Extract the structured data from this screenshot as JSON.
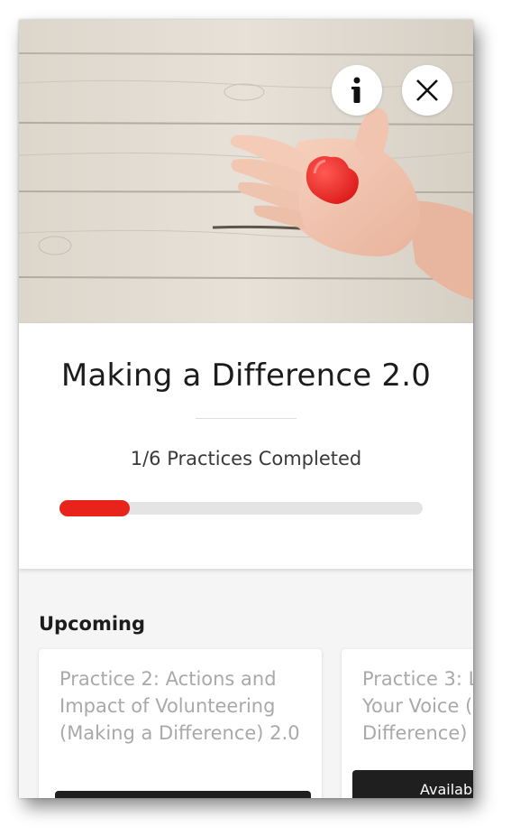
{
  "course": {
    "title": "Making a Difference 2.0",
    "progress_text": "1/6 Practices Completed",
    "completed": 1,
    "total": 6,
    "accent_color": "#e8231c"
  },
  "hero": {
    "image": "hand-holding-red-heart-on-wood",
    "info_icon": "info-icon",
    "close_icon": "close-icon"
  },
  "upcoming": {
    "heading": "Upcoming",
    "items": [
      {
        "title": "Practice 2: Actions and Impact of Volunteering (Making a Difference) 2.0",
        "button_label": ""
      },
      {
        "title": "Practice 3: L\nYour Voice (\nDifference)",
        "button_label": "Availabl"
      }
    ]
  }
}
